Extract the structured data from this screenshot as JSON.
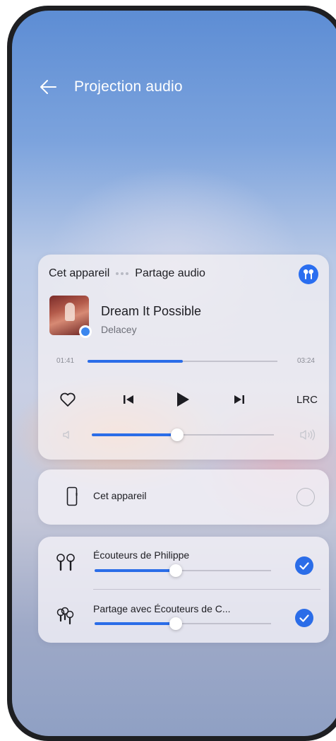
{
  "header": {
    "title": "Projection audio",
    "back_icon": "arrow-left-icon"
  },
  "route": {
    "source": "Cet appareil",
    "target": "Partage audio",
    "badge_icon": "earbuds-icon"
  },
  "track": {
    "title": "Dream It Possible",
    "artist": "Delacey",
    "elapsed": "01:41",
    "total": "03:24",
    "progress": 0.5
  },
  "controls": {
    "favorite_icon": "heart-outline-icon",
    "previous_icon": "skip-previous-icon",
    "play_icon": "play-icon",
    "next_icon": "skip-next-icon",
    "lyrics_label": "LRC"
  },
  "volume": {
    "level": 0.47,
    "low_icon": "volume-low-icon",
    "high_icon": "volume-high-icon"
  },
  "devices": [
    {
      "label": "Cet appareil",
      "icon": "phone-icon",
      "selected": false
    }
  ],
  "outputs": [
    {
      "label": "Écouteurs de Philippe",
      "icon": "earbuds-icon",
      "volume": 0.46,
      "checked": true
    },
    {
      "label": "Partage avec Écouteurs de C...",
      "icon": "shared-earbuds-icon",
      "volume": 0.46,
      "checked": true
    }
  ],
  "colors": {
    "accent": "#2b6de8",
    "text": "#1d1d22",
    "secondary": "#6d6f78"
  }
}
